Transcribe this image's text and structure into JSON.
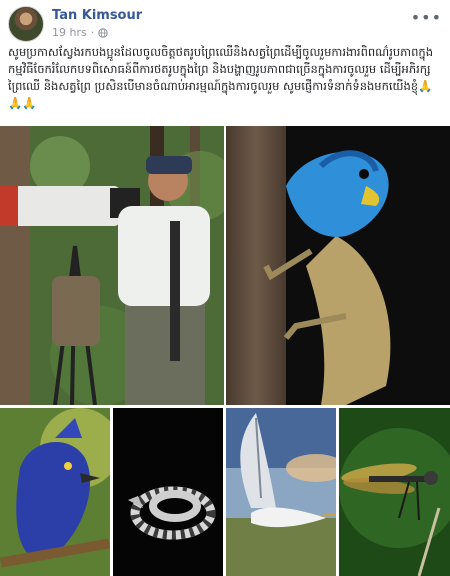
{
  "post": {
    "author": "Tan Kimsour",
    "time": "19 hrs",
    "privacy_icon": "globe-icon",
    "more_icon": "more-options-icon",
    "text": "សូមប្រកាសស្វែងរកបងប្អូនដែលចូលចិត្តថតរូបព្រៃឈើនិងសត្វព្រៃដើម្បីចូលរួមការងារពិពណ៌រូបភាពក្នុងកម្មវិធីចែករំលែកបទពិសោធន៍ពីការថតរូបក្នុងព្រៃ និងបង្ហាញរូបភាពជាច្រើនក្នុងការចូលរួម ដើម្បីអភិរក្សព្រៃឈើ និងសត្វព្រៃ ប្រសិនបើមានចំណាប់អារម្មណ៍ក្នុងការចូលរួម សូមផ្ញើការទំនាក់ទំនងមកយើងខ្ញុំ🙏🙏🙏"
  },
  "gallery": {
    "photos": [
      {
        "subject": "photographer-with-telephoto-lens"
      },
      {
        "subject": "blue-headed-lizard-on-tree"
      },
      {
        "subject": "blue-bird-on-branch"
      },
      {
        "subject": "coiled-snake-on-black"
      },
      {
        "subject": "heron-in-flight"
      },
      {
        "subject": "dragonfly-on-stem"
      }
    ]
  },
  "colors": {
    "author_link": "#385898",
    "meta_text": "#90949c",
    "lizard_blue": "#2f8fd8"
  }
}
